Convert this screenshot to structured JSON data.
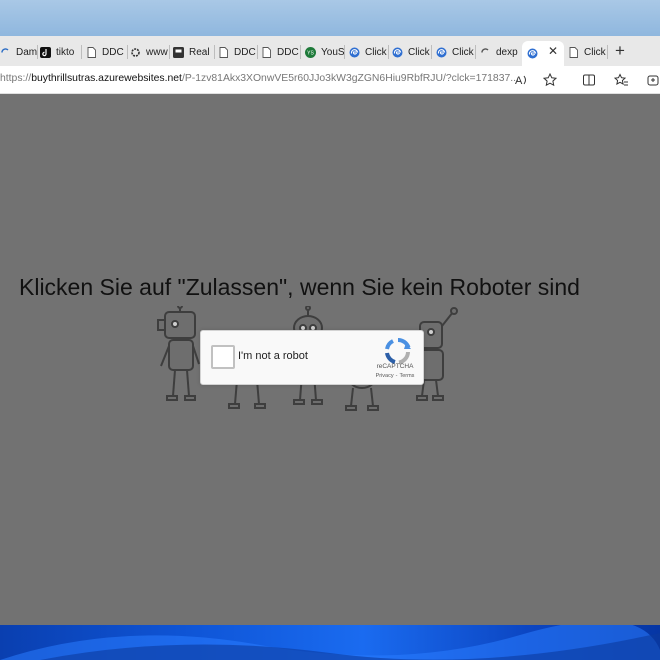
{
  "tabs": [
    {
      "label": "Dam",
      "icon": "loading-icon"
    },
    {
      "label": "tikto",
      "icon": "tiktok-icon"
    },
    {
      "label": "DDC",
      "icon": "page-icon"
    },
    {
      "label": "www",
      "icon": "settings-icon"
    },
    {
      "label": "Real",
      "icon": "app-icon"
    },
    {
      "label": "DDC",
      "icon": "page-icon"
    },
    {
      "label": "DDC",
      "icon": "page-icon"
    },
    {
      "label": "YouS",
      "icon": "youtube-icon"
    },
    {
      "label": "Click",
      "icon": "edge-icon"
    },
    {
      "label": "Click",
      "icon": "edge-icon"
    },
    {
      "label": "Click",
      "icon": "edge-icon"
    },
    {
      "label": "dexp",
      "icon": "loading-icon"
    },
    {
      "label": "",
      "icon": "edge-icon",
      "active": true
    },
    {
      "label": "Click",
      "icon": "page-icon"
    }
  ],
  "address": {
    "prefix": "https://",
    "host": "buythrillsutras.azurewebsites.net",
    "path": "/P-1zv81Akx3XOnwVE5r60JJo3kW3gZGN6Hiu9RbfRJU/?clck=171837..."
  },
  "page": {
    "headline": "Klicken Sie auf \"Zulassen\", wenn Sie kein Roboter sind",
    "captcha": {
      "checkbox_label": "I'm not a robot",
      "brand": "reCAPTCHA",
      "privacy": "Privacy",
      "separator": "-",
      "terms": "Terms"
    }
  },
  "colors": {
    "overlay": "#727272",
    "tabbar": "#e8e8e8",
    "recaptcha_blue": "#4a90e2",
    "recaptcha_gray": "#b0b0b0"
  }
}
